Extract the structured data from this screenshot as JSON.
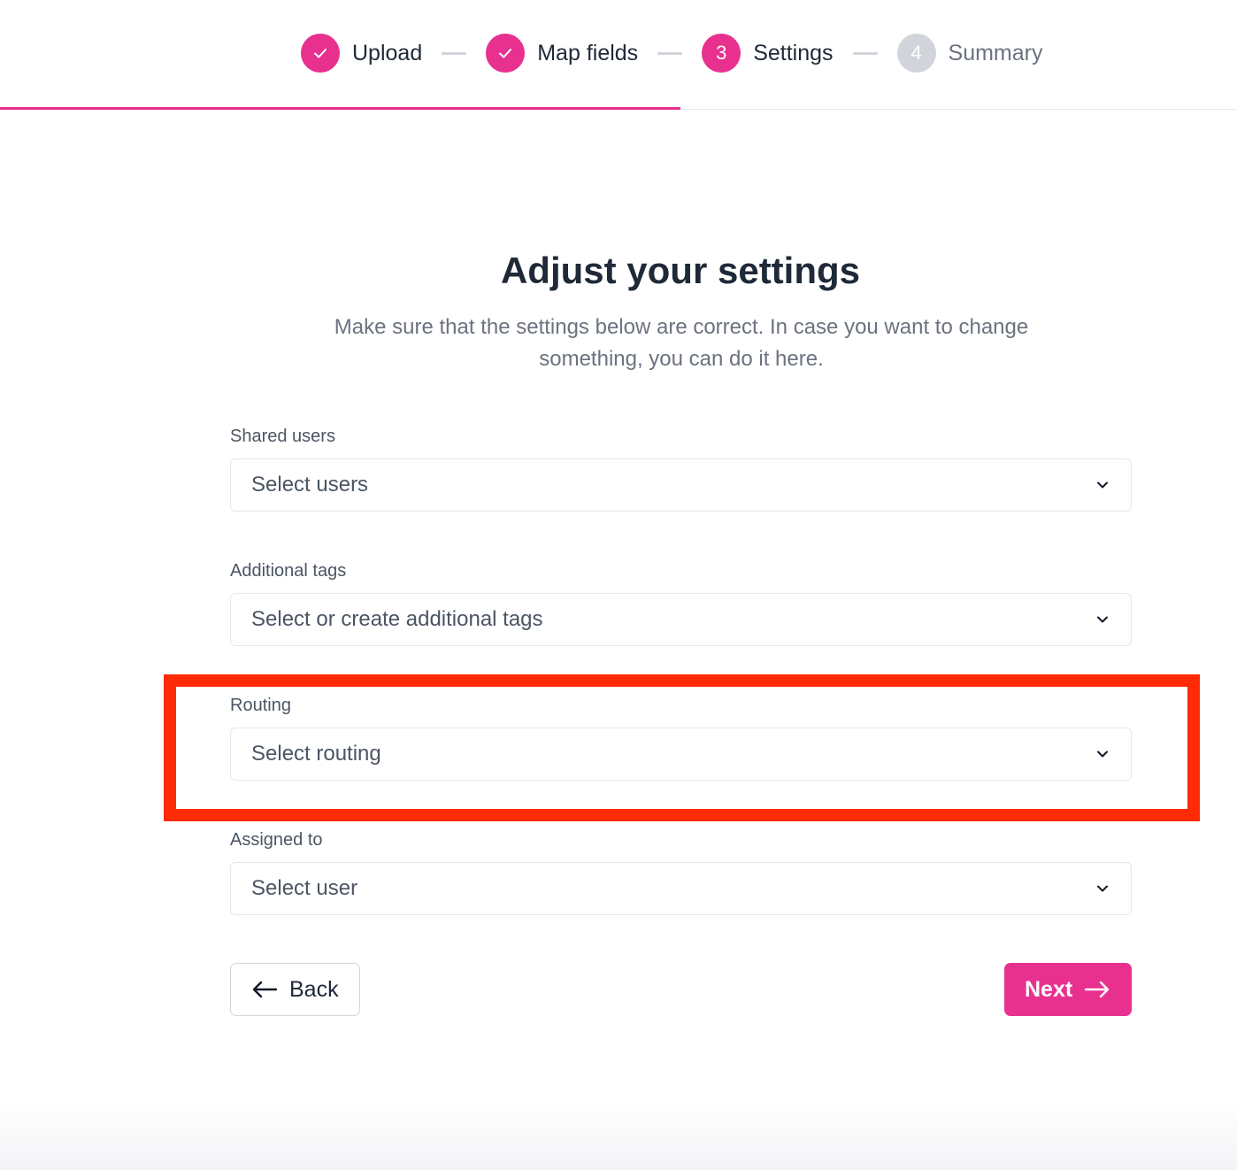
{
  "stepper": {
    "progress_fraction": 0.55,
    "steps": [
      {
        "number": "",
        "label": "Upload",
        "state": "done"
      },
      {
        "number": "",
        "label": "Map fields",
        "state": "done"
      },
      {
        "number": "3",
        "label": "Settings",
        "state": "current"
      },
      {
        "number": "4",
        "label": "Summary",
        "state": "upcoming"
      }
    ]
  },
  "heading": {
    "title": "Adjust your settings",
    "subtitle": "Make sure that the settings below are correct. In case you want to change something, you can do it here."
  },
  "fields": {
    "shared_users": {
      "label": "Shared users",
      "placeholder": "Select users"
    },
    "additional_tags": {
      "label": "Additional tags",
      "placeholder": "Select or create additional tags"
    },
    "routing": {
      "label": "Routing",
      "placeholder": "Select routing"
    },
    "assigned_to": {
      "label": "Assigned to",
      "placeholder": "Select user"
    }
  },
  "buttons": {
    "back": "Back",
    "next": "Next"
  },
  "colors": {
    "accent": "#e8308f",
    "highlight": "#ff2a06",
    "inactive": "#d1d5db"
  }
}
